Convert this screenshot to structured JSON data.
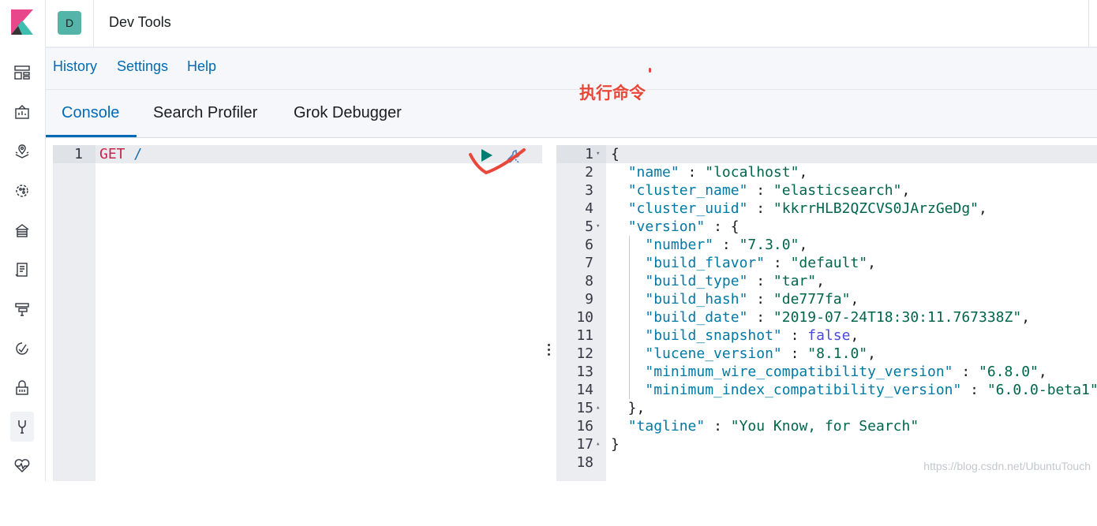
{
  "app": {
    "avatar_letter": "D",
    "title": "Dev Tools"
  },
  "sidebar": {
    "icons": [
      "dashboard-icon",
      "canvas-icon",
      "maps-icon",
      "ml-icon",
      "infrastructure-icon",
      "logs-icon",
      "apm-icon",
      "uptime-icon",
      "siem-icon",
      "dev-tools-icon",
      "monitoring-icon"
    ],
    "active": "dev-tools-icon"
  },
  "menu": {
    "history": "History",
    "settings": "Settings",
    "help": "Help"
  },
  "tabs": {
    "console": "Console",
    "search_profiler": "Search Profiler",
    "grok_debugger": "Grok Debugger"
  },
  "annotation": {
    "text": "执行命令",
    "color": "#e8473a"
  },
  "editor": {
    "line_number": "1",
    "method": "GET",
    "path": "/"
  },
  "output": {
    "lines": [
      {
        "num": "1",
        "fold": "▾"
      },
      {
        "num": "2"
      },
      {
        "num": "3"
      },
      {
        "num": "4"
      },
      {
        "num": "5",
        "fold": "▾"
      },
      {
        "num": "6"
      },
      {
        "num": "7"
      },
      {
        "num": "8"
      },
      {
        "num": "9"
      },
      {
        "num": "10"
      },
      {
        "num": "11"
      },
      {
        "num": "12"
      },
      {
        "num": "13"
      },
      {
        "num": "14"
      },
      {
        "num": "15",
        "fold": "▴"
      },
      {
        "num": "16"
      },
      {
        "num": "17",
        "fold": "▴"
      },
      {
        "num": "18"
      }
    ],
    "name_key": "\"name\"",
    "name_val": "\"localhost\"",
    "cluster_name_key": "\"cluster_name\"",
    "cluster_name_val": "\"elasticsearch\"",
    "cluster_uuid_key": "\"cluster_uuid\"",
    "cluster_uuid_val": "\"kkrrHLB2QZCVS0JArzGeDg\"",
    "version_key": "\"version\"",
    "number_key": "\"number\"",
    "number_val": "\"7.3.0\"",
    "build_flavor_key": "\"build_flavor\"",
    "build_flavor_val": "\"default\"",
    "build_type_key": "\"build_type\"",
    "build_type_val": "\"tar\"",
    "build_hash_key": "\"build_hash\"",
    "build_hash_val": "\"de777fa\"",
    "build_date_key": "\"build_date\"",
    "build_date_val": "\"2019-07-24T18:30:11.767338Z\"",
    "build_snapshot_key": "\"build_snapshot\"",
    "build_snapshot_val": "false",
    "lucene_version_key": "\"lucene_version\"",
    "lucene_version_val": "\"8.1.0\"",
    "min_wire_key": "\"minimum_wire_compatibility_version\"",
    "min_wire_val": "\"6.8.0\"",
    "min_index_key": "\"minimum_index_compatibility_version\"",
    "min_index_val": "\"6.0.0-beta1\"",
    "tagline_key": "\"tagline\"",
    "tagline_val": "\"You Know, for Search\""
  },
  "watermark": "https://blog.csdn.net/UbuntuTouch"
}
